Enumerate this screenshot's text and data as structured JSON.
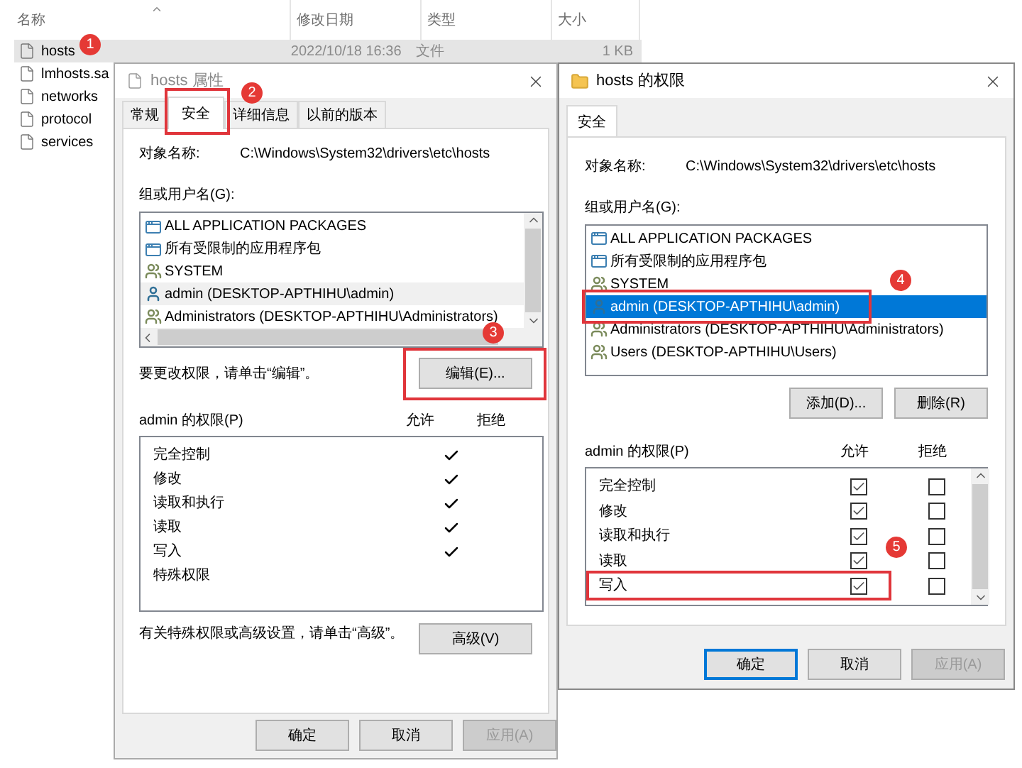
{
  "explorer": {
    "columns": [
      {
        "label": "名称",
        "sorted": true
      },
      {
        "label": "修改日期",
        "sorted": false
      },
      {
        "label": "类型",
        "sorted": false
      },
      {
        "label": "大小",
        "sorted": false
      }
    ],
    "files": [
      {
        "name": "hosts",
        "selected": true,
        "date": "2022/10/18 16:36",
        "type": "文件",
        "size": "1 KB",
        "callout": {
          "number": "1",
          "framed": false
        }
      },
      {
        "name": "lmhosts.sa",
        "selected": false
      },
      {
        "name": "networks",
        "selected": false
      },
      {
        "name": "protocol",
        "selected": false
      },
      {
        "name": "services",
        "selected": false
      }
    ]
  },
  "properties_dialog": {
    "title": "hosts 属性",
    "tabs": [
      {
        "label": "常规",
        "selected": false
      },
      {
        "label": "安全",
        "selected": true,
        "callout": {
          "number": "2",
          "framed": true
        }
      },
      {
        "label": "详细信息",
        "selected": false
      },
      {
        "label": "以前的版本",
        "selected": false
      }
    ],
    "object_label": "对象名称:",
    "object_path": "C:\\Windows\\System32\\drivers\\etc\\hosts",
    "group_label": "组或用户名(G):",
    "groups": [
      {
        "name": "ALL APPLICATION PACKAGES",
        "kind": "package",
        "selected": false
      },
      {
        "name": "所有受限制的应用程序包",
        "kind": "package",
        "selected": false
      },
      {
        "name": "SYSTEM",
        "kind": "group",
        "selected": false
      },
      {
        "name": "admin (DESKTOP-APTHIHU\\admin)",
        "kind": "user",
        "selected": true
      },
      {
        "name": "Administrators (DESKTOP-APTHIHU\\Administrators)",
        "kind": "group",
        "selected": false
      }
    ],
    "edit_hint": "要更改权限，请单击“编辑”。",
    "edit_button": {
      "label": "编辑(E)...",
      "callout": {
        "number": "3",
        "framed": true
      }
    },
    "permissions_label": "admin 的权限(P)",
    "allow_header": "允许",
    "deny_header": "拒绝",
    "permissions": [
      {
        "name": "完全控制",
        "allow": true,
        "deny": false
      },
      {
        "name": "修改",
        "allow": true,
        "deny": false
      },
      {
        "name": "读取和执行",
        "allow": true,
        "deny": false
      },
      {
        "name": "读取",
        "allow": true,
        "deny": false
      },
      {
        "name": "写入",
        "allow": true,
        "deny": false
      },
      {
        "name": "特殊权限",
        "allow": false,
        "deny": false
      }
    ],
    "advanced_hint": "有关特殊权限或高级设置，请单击“高级”。",
    "advanced_button": "高级(V)",
    "buttons": [
      {
        "label": "确定",
        "disabled": false,
        "default": false
      },
      {
        "label": "取消",
        "disabled": false,
        "default": false
      },
      {
        "label": "应用(A)",
        "disabled": true,
        "default": false
      }
    ]
  },
  "permissions_dialog": {
    "title": "hosts 的权限",
    "tabs": [
      {
        "label": "安全",
        "selected": true
      }
    ],
    "object_label": "对象名称:",
    "object_path": "C:\\Windows\\System32\\drivers\\etc\\hosts",
    "group_label": "组或用户名(G):",
    "groups": [
      {
        "name": "ALL APPLICATION PACKAGES",
        "kind": "package",
        "selected": false
      },
      {
        "name": "所有受限制的应用程序包",
        "kind": "package",
        "selected": false
      },
      {
        "name": "SYSTEM",
        "kind": "group",
        "selected": false
      },
      {
        "name": "admin (DESKTOP-APTHIHU\\admin)",
        "kind": "user",
        "selected": true,
        "callout": {
          "number": "4",
          "framed": true
        }
      },
      {
        "name": "Administrators (DESKTOP-APTHIHU\\Administrators)",
        "kind": "group",
        "selected": false
      },
      {
        "name": "Users (DESKTOP-APTHIHU\\Users)",
        "kind": "group",
        "selected": false
      }
    ],
    "add_button": "添加(D)...",
    "remove_button": "删除(R)",
    "permissions_label": "admin 的权限(P)",
    "allow_header": "允许",
    "deny_header": "拒绝",
    "permissions": [
      {
        "name": "完全控制",
        "allow": true,
        "deny": false
      },
      {
        "name": "修改",
        "allow": true,
        "deny": false
      },
      {
        "name": "读取和执行",
        "allow": true,
        "deny": false
      },
      {
        "name": "读取",
        "allow": true,
        "deny": false
      },
      {
        "name": "写入",
        "allow": true,
        "deny": false,
        "callout": {
          "number": "5",
          "framed": true
        }
      }
    ],
    "buttons": [
      {
        "label": "确定",
        "disabled": false,
        "default": true
      },
      {
        "label": "取消",
        "disabled": false,
        "default": false
      },
      {
        "label": "应用(A)",
        "disabled": true,
        "default": false
      }
    ]
  }
}
